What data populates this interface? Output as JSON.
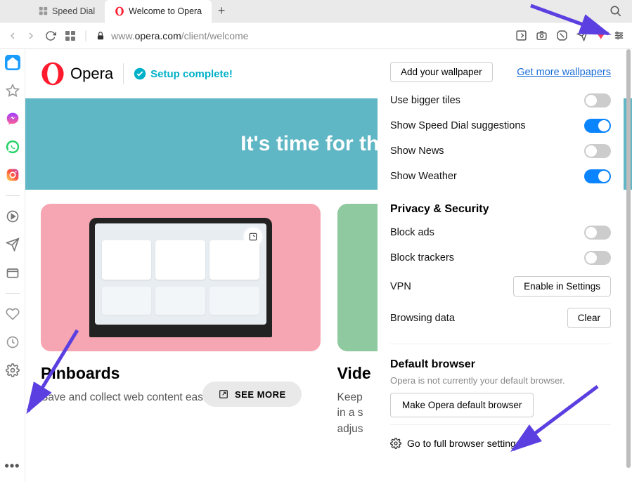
{
  "window": {
    "traffic": [
      "red",
      "yellow",
      "green"
    ]
  },
  "tabs": [
    {
      "label": "Speed Dial",
      "active": false
    },
    {
      "label": "Welcome to Opera",
      "active": true
    }
  ],
  "toolbar": {
    "url_domain_pre": "www.",
    "url_domain": "opera.com",
    "url_path": "/client/welcome"
  },
  "sidebar": {
    "items": [
      "home",
      "star",
      "messenger",
      "whatsapp",
      "instagram",
      "",
      "play-circle",
      "send",
      "wallet",
      "",
      "heart",
      "clock",
      "gear"
    ]
  },
  "page": {
    "brand": "Opera",
    "setup_text": "Setup complete!",
    "hero": "It's time for the re",
    "cards": [
      {
        "title": "Pinboards",
        "body": "Save and collect web content easily, share it visually.",
        "see_more": "SEE MORE"
      },
      {
        "title": "Vide",
        "body": "Keep\nin a s\nadjus"
      }
    ]
  },
  "panel": {
    "wallpaper_btn": "Add your wallpaper",
    "wallpaper_link": "Get more wallpapers",
    "toggles": [
      {
        "label": "Use bigger tiles",
        "on": false
      },
      {
        "label": "Show Speed Dial suggestions",
        "on": true
      },
      {
        "label": "Show News",
        "on": false
      },
      {
        "label": "Show Weather",
        "on": true
      }
    ],
    "privacy_title": "Privacy & Security",
    "privacy_rows": [
      {
        "label": "Block ads",
        "type": "toggle",
        "on": false
      },
      {
        "label": "Block trackers",
        "type": "toggle",
        "on": false
      },
      {
        "label": "VPN",
        "type": "button",
        "btn": "Enable in Settings"
      },
      {
        "label": "Browsing data",
        "type": "button",
        "btn": "Clear"
      }
    ],
    "default_title": "Default browser",
    "default_sub": "Opera is not currently your default browser.",
    "default_btn": "Make Opera default browser",
    "full_settings": "Go to full browser settings"
  }
}
